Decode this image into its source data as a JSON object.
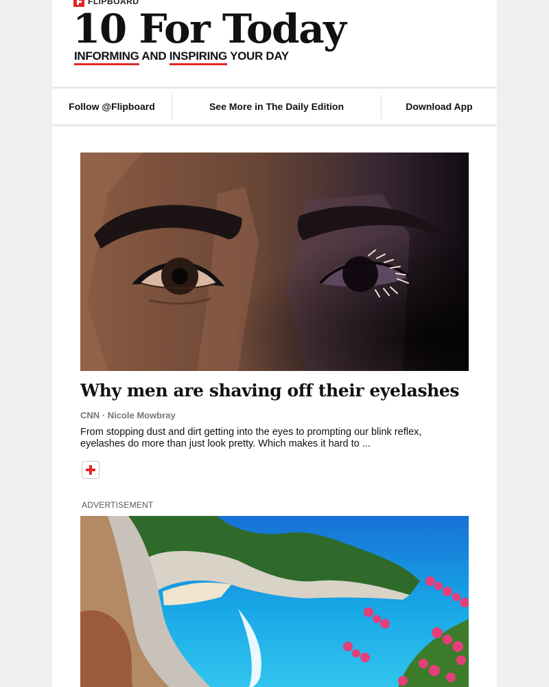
{
  "header": {
    "brand": "FLIPBOARD",
    "title": "10 For Today",
    "tagline": {
      "word1": "INFORMING",
      "and": "AND",
      "word2": "INSPIRING",
      "rest": "YOUR DAY"
    }
  },
  "nav": {
    "follow": "Follow @Flipboard",
    "more": "See More in The Daily Edition",
    "download": "Download App"
  },
  "article": {
    "image_icon": "eyes-illustration",
    "headline": "Why men are shaving off their eyelashes",
    "source": "CNN · Nicole Mowbray",
    "summary": "From stopping dust and dirt getting into the eyes to prompting our blink reflex, eyelashes do more than just look pretty. Which makes it hard to ...",
    "flip_icon": "flip-plus-icon"
  },
  "ad": {
    "label": "ADVERTISEMENT",
    "image_icon": "beach-cove-photo"
  },
  "colors": {
    "accent": "#e12828",
    "background": "#efefef",
    "page": "#ffffff"
  }
}
